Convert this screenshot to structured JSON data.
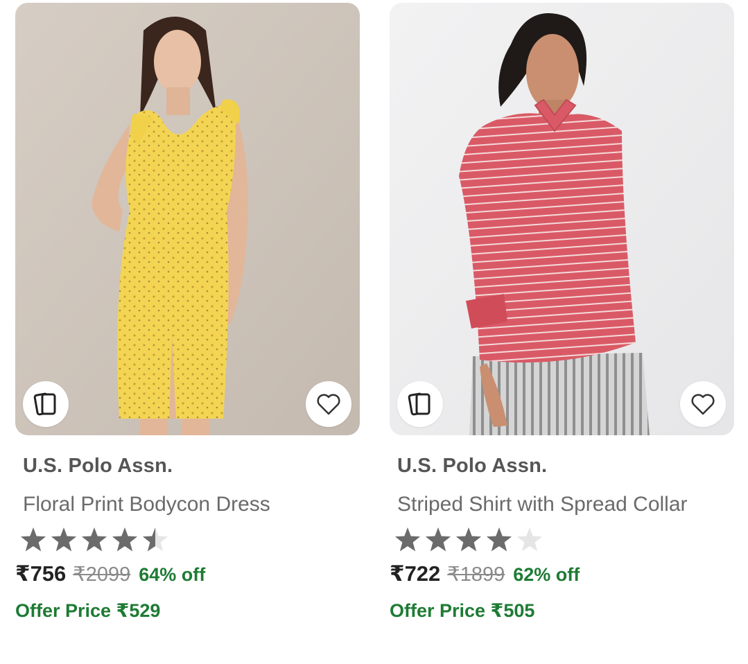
{
  "products": [
    {
      "brand": "U.S. Polo Assn.",
      "name": "Floral Print Bodycon Dress",
      "rating": 4.5,
      "price": "₹756",
      "mrp": "₹2099",
      "discount": "64% off",
      "offer_price": "Offer Price ₹529",
      "image": "woman-in-yellow-floral-dress"
    },
    {
      "brand": "U.S. Polo Assn.",
      "name": "Striped Shirt with Spread Collar",
      "rating": 4,
      "price": "₹722",
      "mrp": "₹1899",
      "discount": "62% off",
      "offer_price": "Offer Price ₹505",
      "image": "woman-in-pink-striped-shirt"
    }
  ],
  "icons": {
    "compare": "compare-cards-icon",
    "wishlist": "heart-icon",
    "star_filled": "star-icon",
    "star_empty": "star-empty-icon"
  },
  "colors": {
    "star_filled": "#6b6b6b",
    "star_empty": "#e5e5e5",
    "discount": "#1e7b34",
    "price": "#222222"
  }
}
